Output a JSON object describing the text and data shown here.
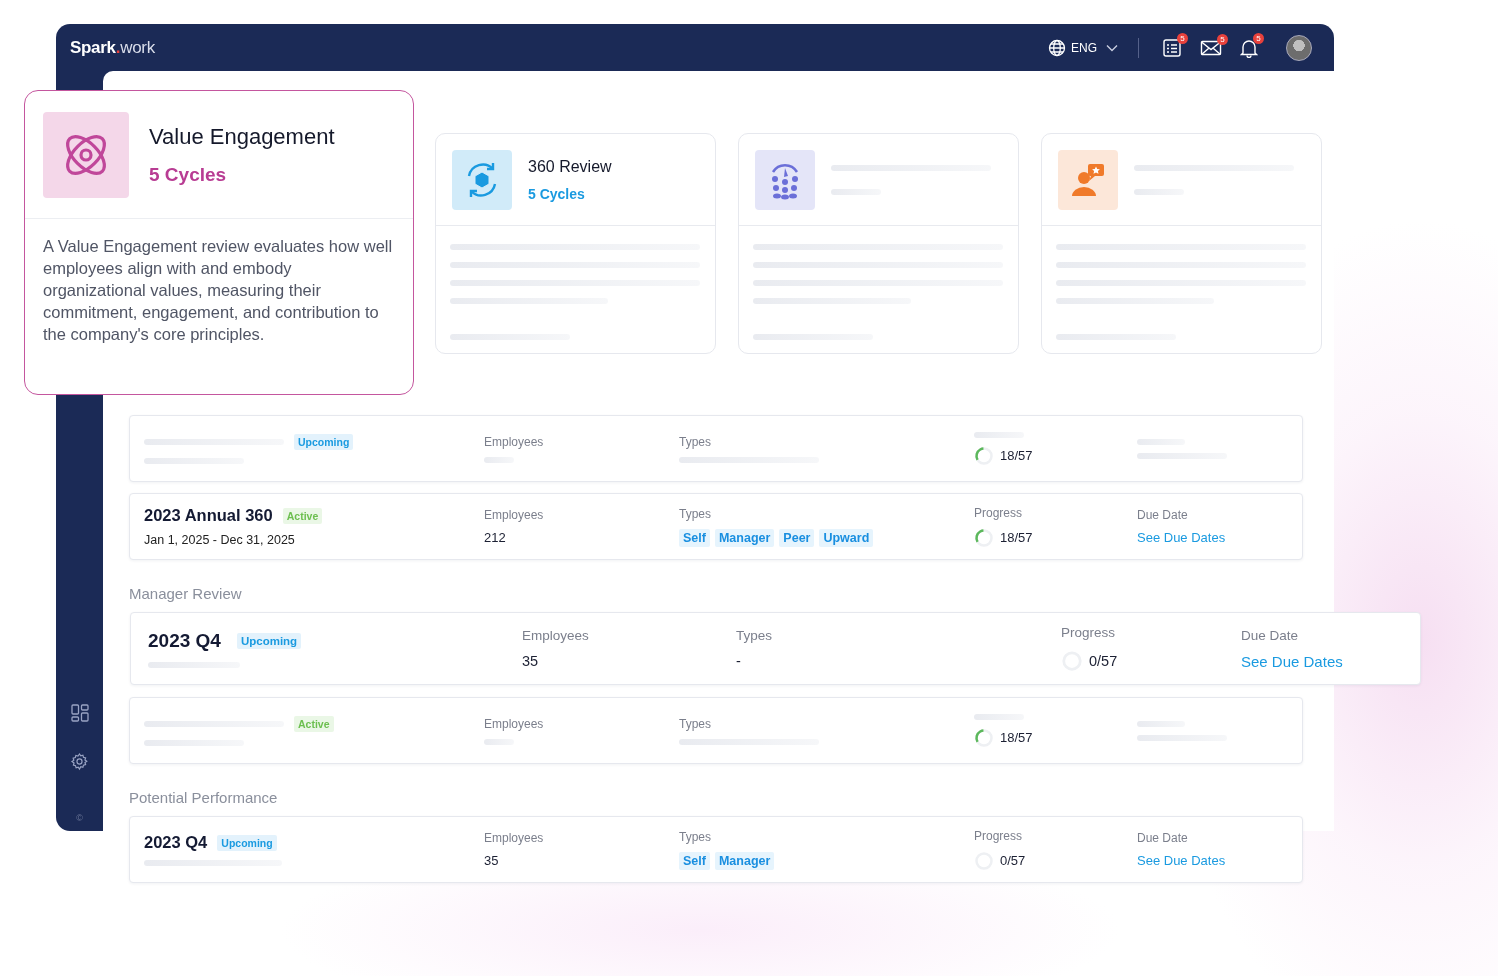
{
  "topbar": {
    "logo": {
      "brand": "Spark",
      "dot": ".",
      "suffix": "work"
    },
    "language": "ENG",
    "notifications": [
      {
        "count": "5"
      },
      {
        "count": "5"
      },
      {
        "count": "5"
      }
    ]
  },
  "sidebar": {
    "footer": "©"
  },
  "value_card": {
    "title": "Value Engagement",
    "cycles": "5 Cycles",
    "description": "A Value Engagement review evaluates how well employees align with and embody organizational values, measuring their commitment, engagement, and contribution to the company's core principles."
  },
  "category_cards": [
    {
      "kind": "filled",
      "title": "360 Review",
      "cycles": "5 Cycles",
      "color": "#1a9ae0"
    },
    {
      "kind": "placeholder",
      "color": "#6b6fd8"
    },
    {
      "kind": "placeholder",
      "color": "#f07a2a"
    }
  ],
  "sections": [
    {
      "rows": [
        {
          "kind": "placeholder",
          "status": {
            "label": "Upcoming",
            "kind": "upcoming"
          },
          "employees_label": "Employees",
          "types_label": "Types",
          "progress": "18/57",
          "level": 0.32
        },
        {
          "kind": "filled",
          "name": "2023 Annual 360",
          "status": {
            "label": "Active",
            "kind": "active"
          },
          "dates": "Jan 1, 2025 - Dec 31, 2025",
          "employees_label": "Employees",
          "employees": "212",
          "types_label": "Types",
          "types": [
            "Self",
            "Manager",
            "Peer",
            "Upward"
          ],
          "progress_label": "Progress",
          "progress": "18/57",
          "level": 0.32,
          "due_label": "Due Date",
          "due_link": "See Due Dates"
        }
      ]
    },
    {
      "title": "Manager Review",
      "rows": [
        {
          "kind": "featured",
          "name": "2023 Q4",
          "status": {
            "label": "Upcoming",
            "kind": "upcoming"
          },
          "employees_label": "Employees",
          "employees": "35",
          "types_label": "Types",
          "types_text": "-",
          "progress_label": "Progress",
          "progress": "0/57",
          "level": 0,
          "due_label": "Due Date",
          "due_link": "See Due Dates"
        },
        {
          "kind": "placeholder",
          "status": {
            "label": "Active",
            "kind": "active"
          },
          "employees_label": "Employees",
          "types_label": "Types",
          "progress": "18/57",
          "level": 0.32
        }
      ]
    },
    {
      "title": "Potential Performance",
      "rows": [
        {
          "kind": "filled",
          "name": "2023 Q4",
          "status": {
            "label": "Upcoming",
            "kind": "upcoming"
          },
          "employees_label": "Employees",
          "employees": "35",
          "types_label": "Types",
          "types": [
            "Self",
            "Manager"
          ],
          "progress_label": "Progress",
          "progress": "0/57",
          "level": 0,
          "due_label": "Due Date",
          "due_link": "See Due Dates"
        }
      ]
    }
  ]
}
